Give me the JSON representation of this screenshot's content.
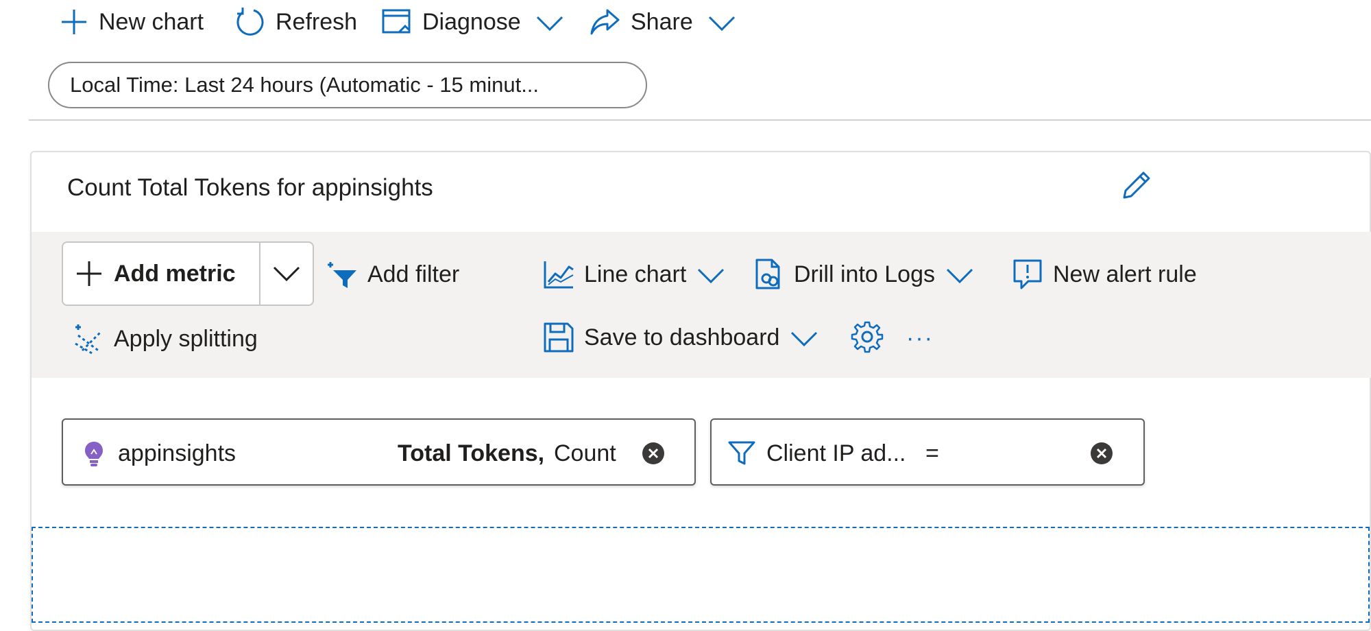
{
  "command_bar": {
    "new_chart": "New chart",
    "refresh": "Refresh",
    "diagnose": "Diagnose",
    "share": "Share"
  },
  "time_range": {
    "label": "Local Time: Last 24 hours (Automatic - 15 minut..."
  },
  "chart": {
    "title": "Count Total Tokens for appinsights",
    "toolbar": {
      "add_metric": "Add metric",
      "add_filter": "Add filter",
      "line_chart": "Line chart",
      "drill_into_logs": "Drill into Logs",
      "new_alert_rule": "New alert rule",
      "apply_splitting": "Apply splitting",
      "save_to_dashboard": "Save to dashboard",
      "more": "···"
    },
    "metric_chip": {
      "resource": "appinsights",
      "metric": "Total Tokens,",
      "aggregation": "Count"
    },
    "filter_chip": {
      "property": "Client IP ad...",
      "operator": "="
    }
  },
  "colors": {
    "accent": "#0f6cbd",
    "bulb": "#8661c5",
    "toolbar_bg": "#f3f2f1"
  },
  "icons": [
    "plus-icon",
    "refresh-icon",
    "diagnose-icon",
    "chevron-down-icon",
    "share-icon",
    "edit-pencil-icon",
    "add-filter-icon",
    "line-chart-icon",
    "drill-logs-icon",
    "alert-icon",
    "splitting-icon",
    "save-icon",
    "gear-icon",
    "more-icon",
    "lightbulb-icon",
    "filter-icon",
    "remove-icon"
  ]
}
